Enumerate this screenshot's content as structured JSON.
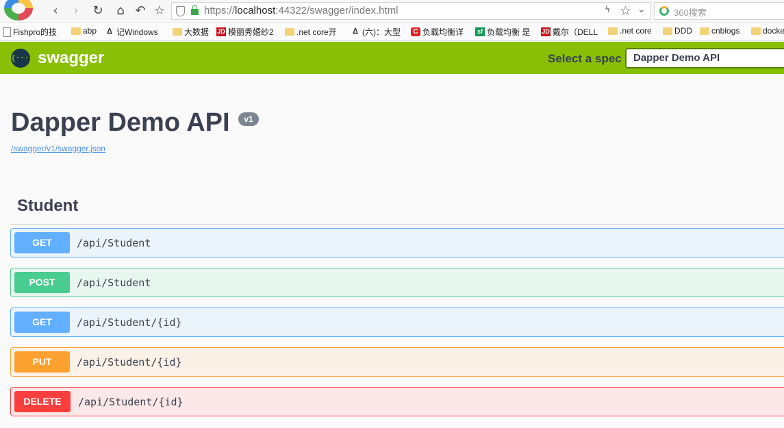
{
  "browser": {
    "url_scheme": "https://",
    "url_host": "localhost",
    "url_rest": ":44322/swagger/index.html",
    "search_placeholder": "360搜索",
    "bookmarks": [
      {
        "label": "Fishpro的技",
        "icon": "page"
      },
      {
        "label": "abp",
        "icon": "folder"
      },
      {
        "label": "记Windows",
        "icon": "ghost"
      },
      {
        "label": "大数据",
        "icon": "folder"
      },
      {
        "label": "模丽秀婚纱2",
        "icon": "jd"
      },
      {
        "label": ".net core开",
        "icon": "folder"
      },
      {
        "label": "(六)：大型",
        "icon": "ghost"
      },
      {
        "label": "负载均衡详",
        "icon": "c"
      },
      {
        "label": "负载均衡 是",
        "icon": "sf"
      },
      {
        "label": "戴尔（DELL",
        "icon": "jd"
      },
      {
        "label": ".net core",
        "icon": "folder"
      },
      {
        "label": "DDD",
        "icon": "folder"
      },
      {
        "label": "cnblogs",
        "icon": "folder"
      },
      {
        "label": "docke",
        "icon": "folder"
      }
    ],
    "icon_glyphs": {
      "jd": "JD",
      "c": "C",
      "sf": "sf",
      "ghost": "ᐃ"
    }
  },
  "swagger": {
    "brand": "swagger",
    "logo_glyph": "{···}",
    "spec_label": "Select a spec",
    "spec_selected": "Dapper Demo API",
    "title": "Dapper Demo API",
    "version": "v1",
    "spec_url": "/swagger/v1/swagger.json",
    "tag": "Student",
    "operations": [
      {
        "method": "GET",
        "path": "/api/Student"
      },
      {
        "method": "POST",
        "path": "/api/Student"
      },
      {
        "method": "GET",
        "path": "/api/Student/{id}"
      },
      {
        "method": "PUT",
        "path": "/api/Student/{id}"
      },
      {
        "method": "DELETE",
        "path": "/api/Student/{id}"
      }
    ],
    "colors": {
      "topbar": "#89bf04",
      "get": "#61affe",
      "post": "#49cc90",
      "put": "#fca130",
      "delete": "#f93e3e"
    }
  }
}
